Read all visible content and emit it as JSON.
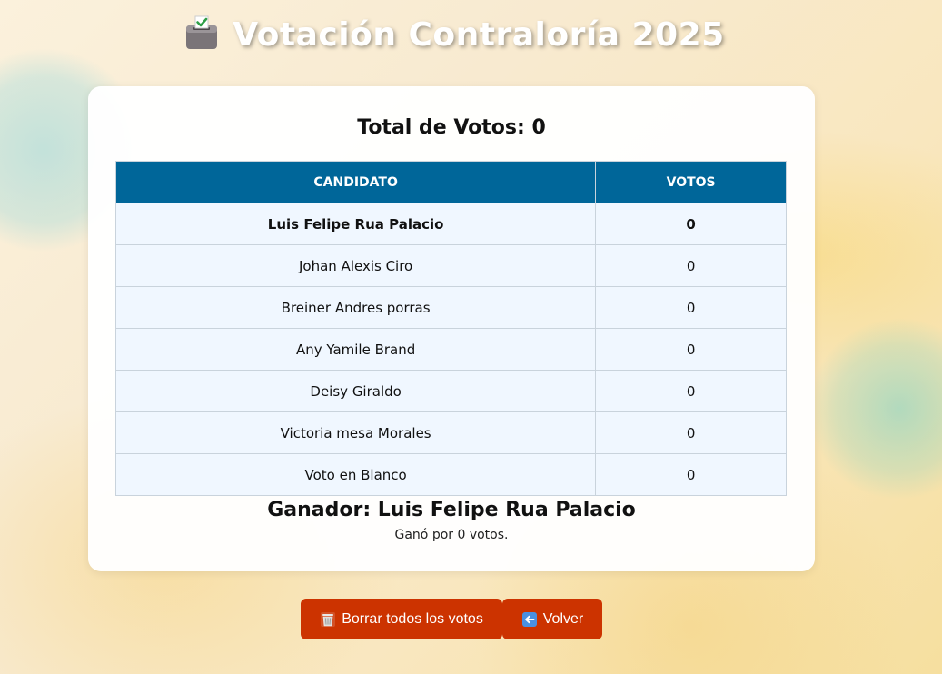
{
  "header": {
    "title": "Votación Contraloría 2025",
    "icon": "ballot-box-icon"
  },
  "summary": {
    "total_label": "Total de Votos: 0"
  },
  "table": {
    "columns": [
      "CANDIDATO",
      "VOTOS"
    ],
    "rows": [
      {
        "candidate": "Luis Felipe Rua Palacio",
        "votes": "0"
      },
      {
        "candidate": "Johan Alexis Ciro",
        "votes": "0"
      },
      {
        "candidate": "Breiner Andres porras",
        "votes": "0"
      },
      {
        "candidate": "Any Yamile Brand",
        "votes": "0"
      },
      {
        "candidate": "Deisy Giraldo",
        "votes": "0"
      },
      {
        "candidate": "Victoria mesa Morales",
        "votes": "0"
      },
      {
        "candidate": "Voto en Blanco",
        "votes": "0"
      }
    ]
  },
  "result": {
    "winner_label": "Ganador: Luis Felipe Rua Palacio",
    "margin_label": "Ganó por 0 votos."
  },
  "actions": {
    "clear_label": "Borrar todos los votos",
    "clear_icon": "wastebasket-icon",
    "back_label": "Volver",
    "back_icon": "left-arrow-icon"
  },
  "colors": {
    "table_header": "#006699",
    "row_background": "#f0f7ff",
    "button": "#cc3300"
  }
}
